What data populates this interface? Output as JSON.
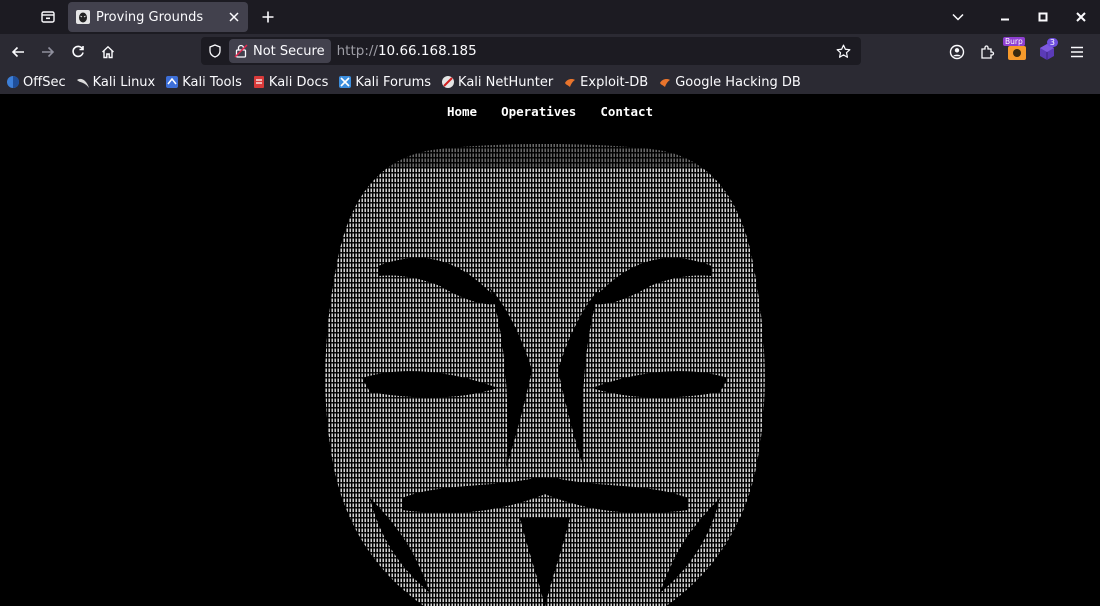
{
  "tabs": [
    {
      "title": "Proving Grounds",
      "active": true
    }
  ],
  "navigation": {
    "security_label": "Not Secure",
    "url_scheme": "http://",
    "url_host": "10.66.168.185"
  },
  "bookmarks": [
    {
      "label": "OffSec",
      "icon": "offsec-icon"
    },
    {
      "label": "Kali Linux",
      "icon": "kali-icon"
    },
    {
      "label": "Kali Tools",
      "icon": "kali-tools-icon"
    },
    {
      "label": "Kali Docs",
      "icon": "kali-docs-icon"
    },
    {
      "label": "Kali Forums",
      "icon": "kali-forums-icon"
    },
    {
      "label": "Kali NetHunter",
      "icon": "nethunter-icon"
    },
    {
      "label": "Exploit-DB",
      "icon": "exploitdb-icon"
    },
    {
      "label": "Google Hacking DB",
      "icon": "ghdb-icon"
    }
  ],
  "extensions": {
    "burp_badge": "Burp",
    "badge_count": "3"
  },
  "site": {
    "nav": [
      "Home",
      "Operatives",
      "Contact"
    ],
    "hero": "ascii-mask-art"
  },
  "colors": {
    "tab_bg": "#1c1b22",
    "toolbar_bg": "#2b2a33",
    "active_tab": "#42414d",
    "page_bg": "#000000",
    "ascii_text": "#e8e8e8"
  }
}
